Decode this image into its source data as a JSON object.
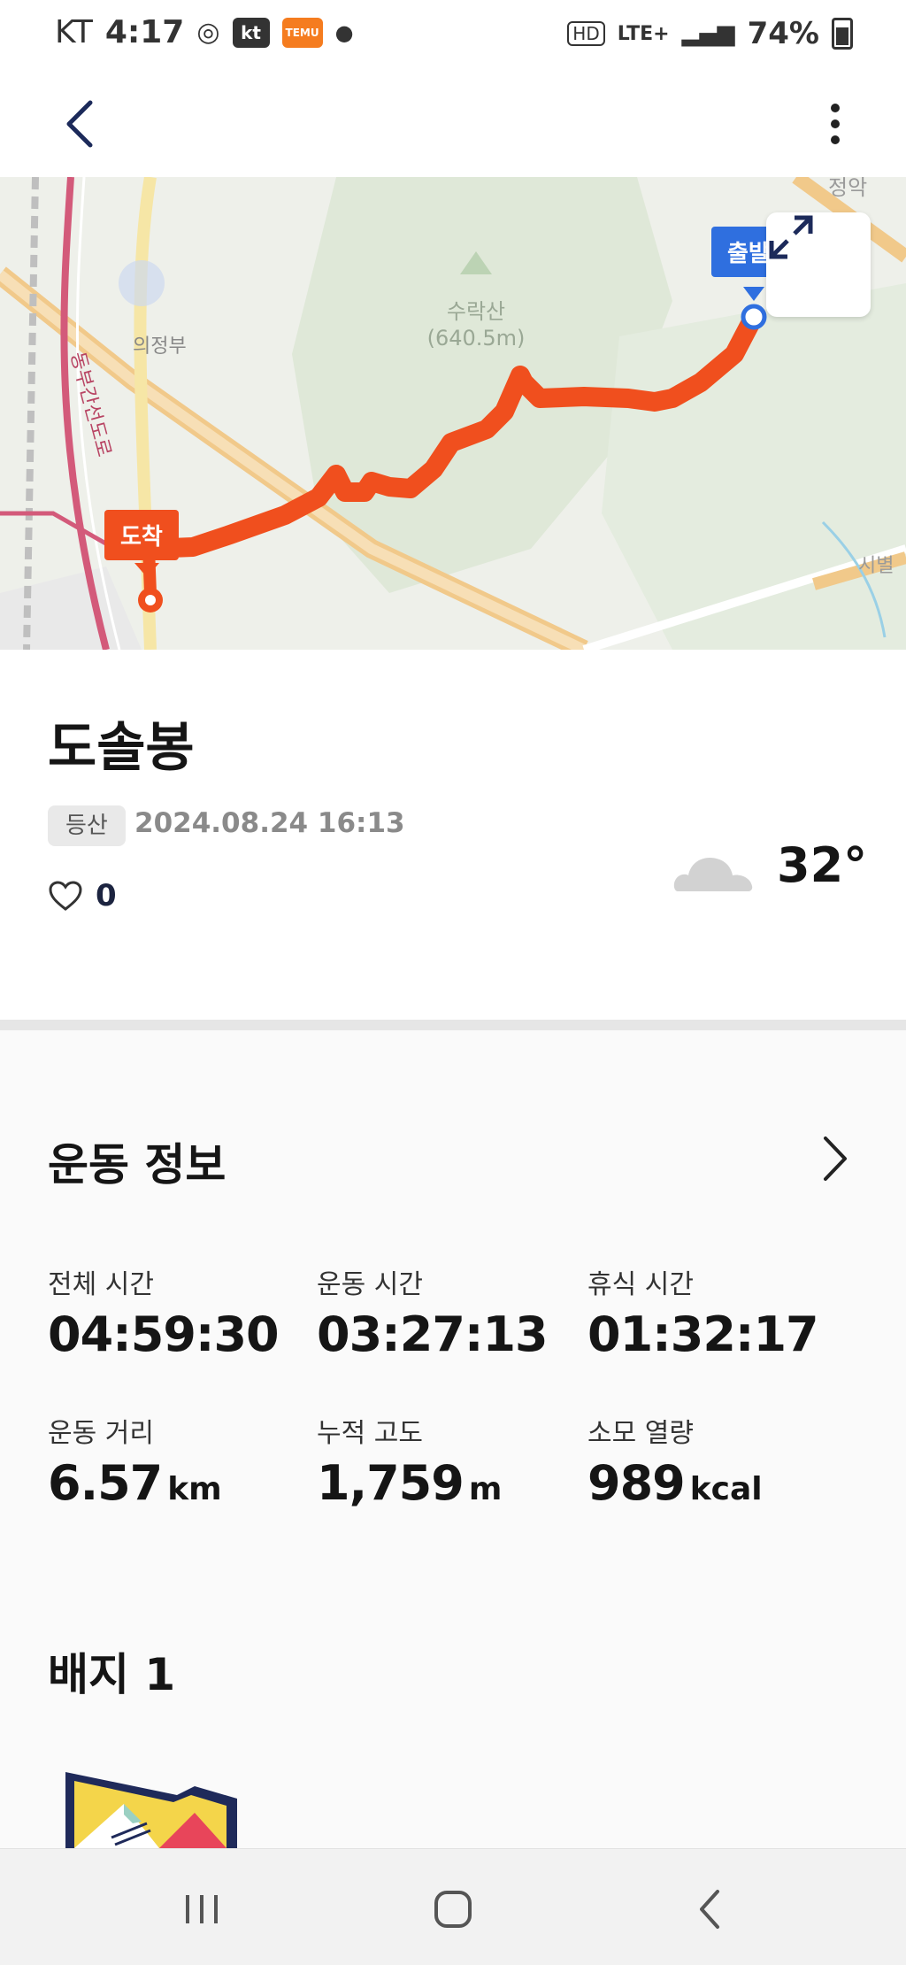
{
  "status": {
    "carrier": "KT",
    "time": "4:17",
    "kt_badge": "kt",
    "temu_badge": "TEMU",
    "hd": "HD",
    "network": "LTE+",
    "battery": "74%"
  },
  "map": {
    "start_label": "출발",
    "end_label": "도착",
    "place_labels": {
      "mountain": "수락산",
      "mountain_height": "(640.5m)",
      "district": "의정부",
      "road": "동부간선도로",
      "right_label": "정악",
      "right_bottom": "시별"
    }
  },
  "activity": {
    "name": "도솔봉",
    "category": "등산",
    "datetime": "2024.08.24 16:13",
    "likes": "0",
    "temperature": "32°",
    "weather_icon": "cloud-icon"
  },
  "exercise": {
    "title": "운동 정보",
    "stats": [
      {
        "label": "전체 시간",
        "value": "04:59:30",
        "unit": ""
      },
      {
        "label": "운동 시간",
        "value": "03:27:13",
        "unit": ""
      },
      {
        "label": "휴식 시간",
        "value": "01:32:17",
        "unit": ""
      },
      {
        "label": "운동 거리",
        "value": "6.57",
        "unit": "km"
      },
      {
        "label": "누적 고도",
        "value": "1,759",
        "unit": "m"
      },
      {
        "label": "소모 열량",
        "value": "989",
        "unit": "kcal"
      }
    ]
  },
  "badges": {
    "title": "배지 1"
  },
  "colors": {
    "route": "#f04f1e",
    "start_pin": "#2f6fdf",
    "road": "#f1c98a"
  }
}
